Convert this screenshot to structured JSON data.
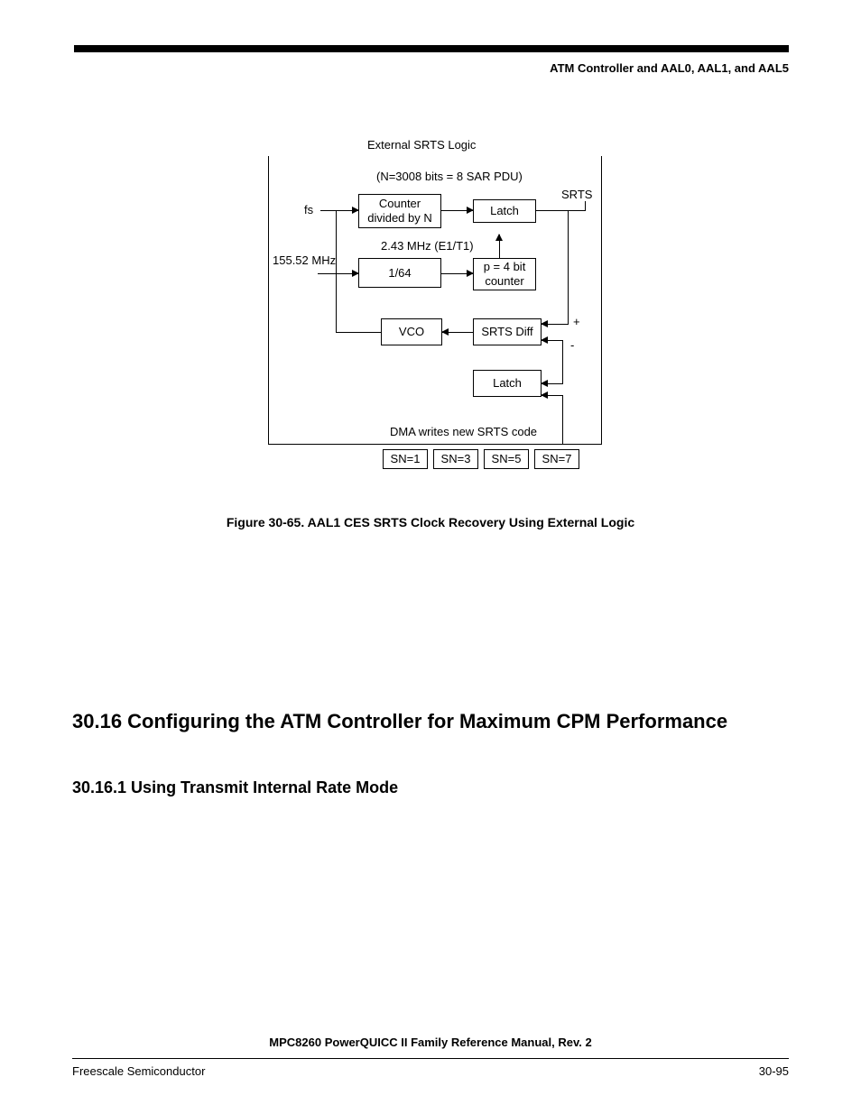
{
  "header": {
    "title_right": "ATM Controller and AAL0, AAL1, and AAL5"
  },
  "diagram": {
    "title": "External SRTS Logic",
    "n_text": "(N=3008 bits = 8 SAR PDU)",
    "srts_label": "SRTS",
    "fs_label": "fs",
    "counter_box": "Counter\ndivided by N",
    "latch_top": "Latch",
    "freq_label": "2.43 MHz (E1/T1)",
    "mhz_label": "155.52 MHz",
    "div64": "1/64",
    "p4bit": "p = 4 bit\ncounter",
    "vco": "VCO",
    "srts_diff": "SRTS Diff",
    "latch_bottom": "Latch",
    "plus": "+",
    "minus": "-",
    "dma_text": "DMA writes new SRTS code",
    "sn1": "SN=1",
    "sn3": "SN=3",
    "sn5": "SN=5",
    "sn7": "SN=7"
  },
  "figure_caption": "Figure 30-65. AAL1 CES SRTS Clock Recovery Using External Logic",
  "section_heading": "30.16  Configuring the ATM Controller for Maximum CPM Performance",
  "subsection_heading": "30.16.1  Using Transmit Internal Rate Mode",
  "footer": {
    "manual_title": "MPC8260 PowerQUICC II Family Reference Manual, Rev. 2",
    "company": "Freescale Semiconductor",
    "page_num": "30-95"
  }
}
